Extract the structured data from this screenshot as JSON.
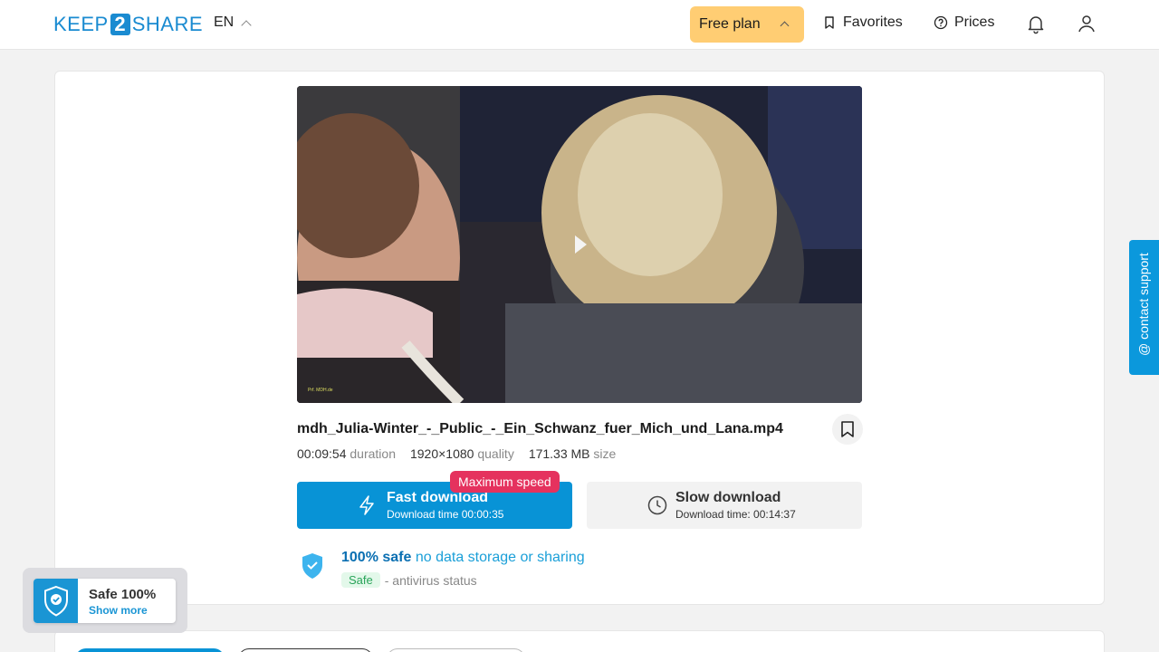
{
  "header": {
    "logo_left": "KEEP",
    "logo_num": "2",
    "logo_right": "SHARE",
    "language": "EN",
    "plan_label": "Free plan",
    "favorites_label": "Favorites",
    "prices_label": "Prices"
  },
  "file": {
    "name": "mdh_Julia-Winter_-_Public_-_Ein_Schwanz_fuer_Mich_und_Lana.mp4",
    "duration_value": "00:09:54",
    "duration_label": "duration",
    "quality_value": "1920×1080",
    "quality_label": "quality",
    "size_value": "171.33 MB",
    "size_label": "size",
    "video_watermark": "Prf. MDH.de"
  },
  "download": {
    "badge": "Maximum speed",
    "fast_title": "Fast download",
    "fast_subtitle": "Download time 00:00:35",
    "slow_title": "Slow download",
    "slow_subtitle": "Download time: 00:14:37"
  },
  "safety": {
    "headline_strong": "100% safe",
    "headline_soft": "no data storage or sharing",
    "status_tag": "Safe",
    "status_label": "- antivirus status"
  },
  "support": {
    "label": "@ contact support"
  },
  "safe_widget": {
    "title": "Safe 100%",
    "link": "Show more"
  },
  "colors": {
    "brand": "#1a8bd1",
    "fast": "#0893d6",
    "badge": "#e5325e",
    "plan": "#ffcd73"
  }
}
